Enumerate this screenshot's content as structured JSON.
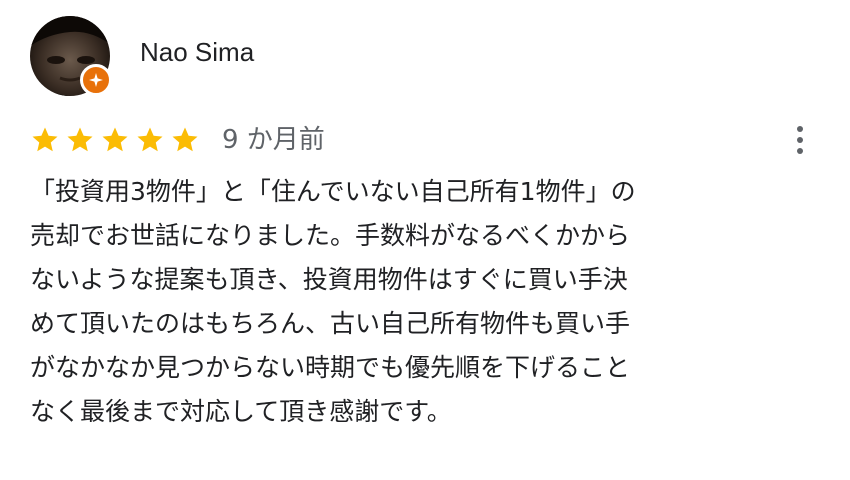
{
  "review": {
    "author": "Nao Sima",
    "badge_icon": "local-guide-badge-icon",
    "rating": 5,
    "max_rating": 5,
    "star_color": "#fbbc04",
    "date": "9 か月前",
    "more_icon": "more-vert-icon",
    "text": "「投資用3物件」と「住んでいない自己所有1物件」の\n売却でお世話になりました。手数料がなるべくかから\nないような提案も頂き、投資用物件はすぐに買い手決\nめて頂いたのはもちろん、古い自己所有物件も買い手\nがなかなか見つからない時期でも優先順を下げること\nなく最後まで対応して頂き感謝です。"
  },
  "colors": {
    "badge": "#e8710a",
    "secondary_text": "#5f6368",
    "primary_text": "#202124"
  }
}
